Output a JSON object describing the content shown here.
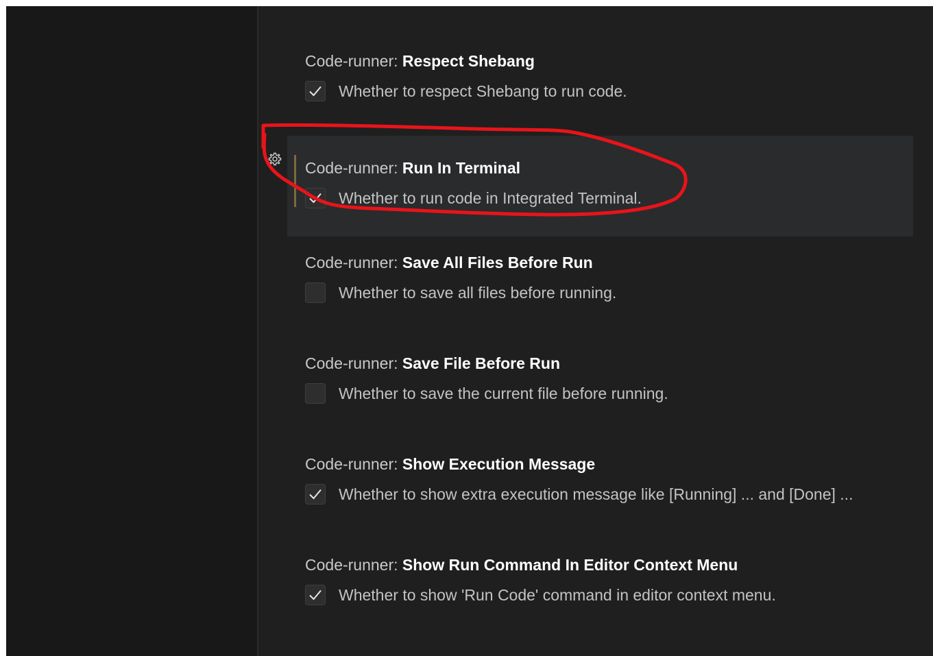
{
  "settings": [
    {
      "category": "Code-runner: ",
      "name": "Respect Shebang",
      "checked": true,
      "description": "Whether to respect Shebang to run code.",
      "focused": false
    },
    {
      "category": "Code-runner: ",
      "name": "Run In Terminal",
      "checked": true,
      "description": "Whether to run code in Integrated Terminal.",
      "focused": true
    },
    {
      "category": "Code-runner: ",
      "name": "Save All Files Before Run",
      "checked": false,
      "description": "Whether to save all files before running.",
      "focused": false
    },
    {
      "category": "Code-runner: ",
      "name": "Save File Before Run",
      "checked": false,
      "description": "Whether to save the current file before running.",
      "focused": false
    },
    {
      "category": "Code-runner: ",
      "name": "Show Execution Message",
      "checked": true,
      "description": "Whether to show extra execution message like [Running] ... and [Done] ...",
      "focused": false
    },
    {
      "category": "Code-runner: ",
      "name": "Show Run Command In Editor Context Menu",
      "checked": true,
      "description": "Whether to show 'Run Code' command in editor context menu.",
      "focused": false
    }
  ],
  "icons": {
    "gear": "gear-icon",
    "check": "checkmark-icon"
  },
  "colors": {
    "background": "#1f1f1f",
    "sidebar": "#181818",
    "focused_row": "#2a2b2d",
    "focus_bar": "#7d6a3c",
    "annotation": "#e8141a"
  }
}
